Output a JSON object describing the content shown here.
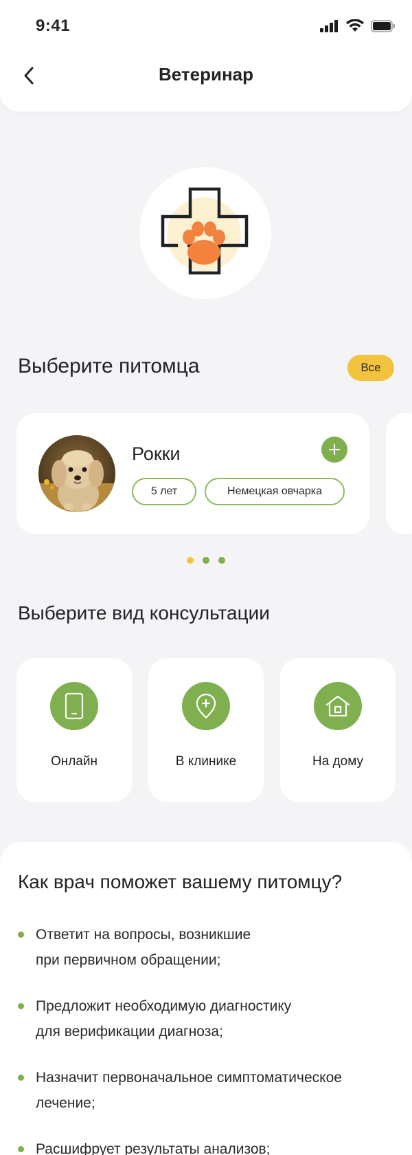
{
  "status_bar": {
    "time": "9:41"
  },
  "header": {
    "title": "Ветеринар"
  },
  "pet_section": {
    "title": "Выберите питомца",
    "all_button": "Все",
    "pet": {
      "name": "Рокки",
      "age": "5 лет",
      "breed": "Немецкая овчарка"
    },
    "pagination": {
      "active_index": 0,
      "count": 3
    }
  },
  "consult_section": {
    "title": "Выберите вид консультации",
    "options": [
      {
        "label": "Онлайн",
        "icon": "phone-icon"
      },
      {
        "label": "В клинике",
        "icon": "location-pin-plus-icon"
      },
      {
        "label": "На дому",
        "icon": "house-icon"
      }
    ]
  },
  "info_section": {
    "title": "Как врач поможет вашему питомцу?",
    "items": [
      {
        "line1": "Ответит на вопросы, возникшие",
        "line2": "при первичном обращении;"
      },
      {
        "line1": "Предложит необходимую диагностику",
        "line2": "для верификации диагноза;"
      },
      {
        "line1": "Назначит первоначальное симптоматическое",
        "line2": "лечение;"
      },
      {
        "line1": "Расшифрует результаты анализов;",
        "line2": ""
      }
    ]
  },
  "colors": {
    "accent_green": "#7FAF4E",
    "accent_yellow": "#F2C33D",
    "paw_orange": "#F4823F",
    "background": "#F4F4F6"
  }
}
